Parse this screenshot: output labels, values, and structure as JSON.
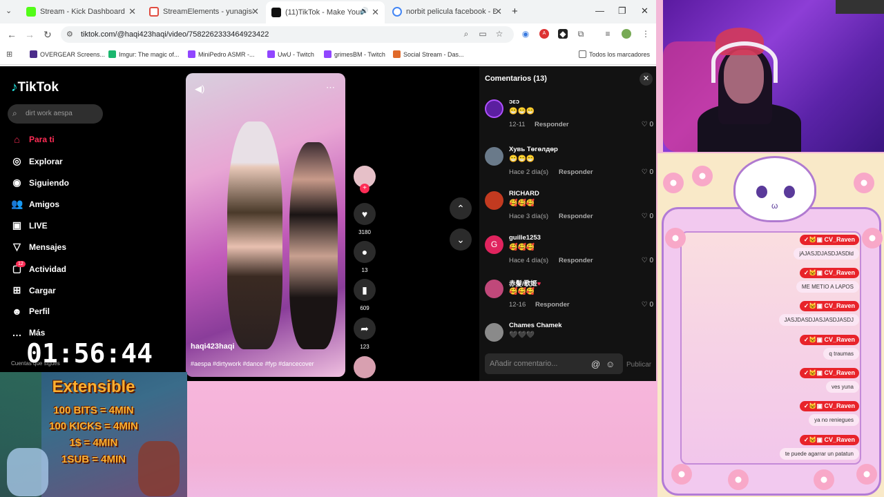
{
  "browser": {
    "tabs": [
      {
        "label": "Stream - Kick Dashboard",
        "color": "#53fc18"
      },
      {
        "label": "StreamElements - yunagiselle",
        "color": "#e04b3f"
      },
      {
        "label": "(11)TikTok - Make Your Day",
        "color": "#111111"
      },
      {
        "label": "norbit pelicula facebook - Busc",
        "color": "#4285f4"
      }
    ],
    "url": "tiktok.com/@haqi423haqi/video/7582262333464923422",
    "bookmarks": [
      "OVERGEAR Screens...",
      "Imgur: The magic of...",
      "MiniPedro ASMR -...",
      "UwU - Twitch",
      "grimesBM - Twitch",
      "Social Stream - Das...",
      "Todos los marcadores"
    ]
  },
  "tiktok": {
    "logo": "TikTok",
    "search_placeholder": "dirt work aespa",
    "nav": [
      {
        "label": "Para ti",
        "icon": "home-icon",
        "active": true
      },
      {
        "label": "Explorar",
        "icon": "compass-icon"
      },
      {
        "label": "Siguiendo",
        "icon": "following-icon"
      },
      {
        "label": "Amigos",
        "icon": "friends-icon"
      },
      {
        "label": "LIVE",
        "icon": "live-icon"
      },
      {
        "label": "Mensajes",
        "icon": "messages-icon"
      },
      {
        "label": "Actividad",
        "icon": "activity-icon",
        "badge": "12"
      },
      {
        "label": "Cargar",
        "icon": "upload-icon"
      },
      {
        "label": "Perfil",
        "icon": "profile-icon"
      },
      {
        "label": "Más",
        "icon": "more-icon"
      }
    ],
    "followed_label": "Cuentas que sigues",
    "video": {
      "author": "haqi423haqi",
      "tags": "#aespa #dirtywork #dance #fyp #dancecover",
      "likes": "3180",
      "comments": "13",
      "saves": "609",
      "shares": "123"
    },
    "comments_panel": {
      "title": "Comentarios (13)",
      "input_placeholder": "Añadir comentario...",
      "publish": "Publicar",
      "reply_label": "Responder",
      "items": [
        {
          "user": "ɔεɔ",
          "text": "😁😁😁",
          "date": "12-11",
          "likes": "0",
          "avatar": "#5b1fa0"
        },
        {
          "user": "Хувь Төгөлдөр",
          "text": "😁😁😁",
          "date": "Hace 2 día(s)",
          "likes": "0",
          "avatar": "#6a7a8a"
        },
        {
          "user": "RICHARD",
          "text": "🥰🥰🥰",
          "date": "Hace 3 día(s)",
          "likes": "0",
          "avatar": "#c23a20"
        },
        {
          "user": "guille1253",
          "text": "🥰🥰🥰",
          "date": "Hace 4 día(s)",
          "likes": "0",
          "avatar": "#e0245e",
          "initial": "G"
        },
        {
          "user": "赤髮/歌姬",
          "heart": "♥",
          "text": "🥰🥰🥰",
          "date": "12-16",
          "likes": "0",
          "avatar": "#c0487a"
        },
        {
          "user": "Chames Chamek",
          "text": "🖤🖤🖤",
          "date": "",
          "likes": "",
          "avatar": "#8a8a8a"
        }
      ]
    }
  },
  "overlay": {
    "timer": "01:56:44",
    "promo": {
      "title": "Extensible",
      "lines": [
        "100 BITS = 4MIN",
        "100 KICKS = 4MIN",
        "1$ = 4MIN",
        "1SUB = 4MIN"
      ]
    },
    "chat": {
      "username": "CV_Raven",
      "messages": [
        "jAJASJDJASDJASDld",
        "ME METIO A LAPOS",
        "JASJDASDJASJASDJASDJ",
        "q traumas",
        "ves yuna",
        "ya no reniegues",
        "te puede agarrar un patatun"
      ]
    }
  }
}
